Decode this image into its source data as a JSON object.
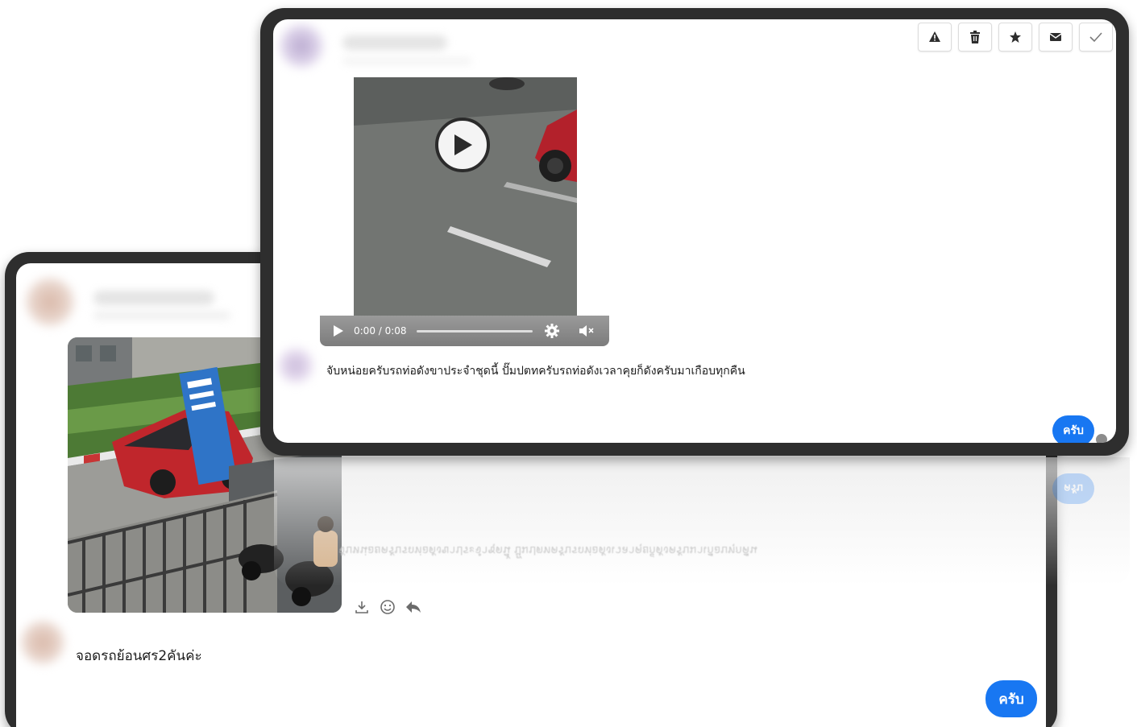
{
  "back_panel": {
    "message_text": "จอดรถย้อนศร2คันค่ะ",
    "reply_label": "ครับ",
    "actions": [
      "download-icon",
      "emoji-icon",
      "reply-icon"
    ]
  },
  "front_panel": {
    "toolbar": [
      "warning-icon",
      "trash-icon",
      "star-icon",
      "mail-icon",
      "check-icon"
    ],
    "video": {
      "time_label": "0:00 / 0:08",
      "progress": 0.0
    },
    "message_text": "จับหน่อยครับรถท่อดังขาประจำชุดนี้ ปั๊มปตทครับรถท่อดังเวลาคุยก็ดังครับมาเกือบทุกคืน",
    "reply_label": "ครับ"
  },
  "reflection": {
    "reply_label": "ครับ",
    "message_text": "จับหน่อยครับรถท่อดังขาประจำชุดนี้ ปั๊มปตทครับรถท่อดังเวลาคุยก็ดังครับมาเกือบทุกคืน"
  },
  "colors": {
    "frame": "#2e2e2e",
    "reply_bubble": "#1877f2",
    "text": "#1c1c1c"
  }
}
